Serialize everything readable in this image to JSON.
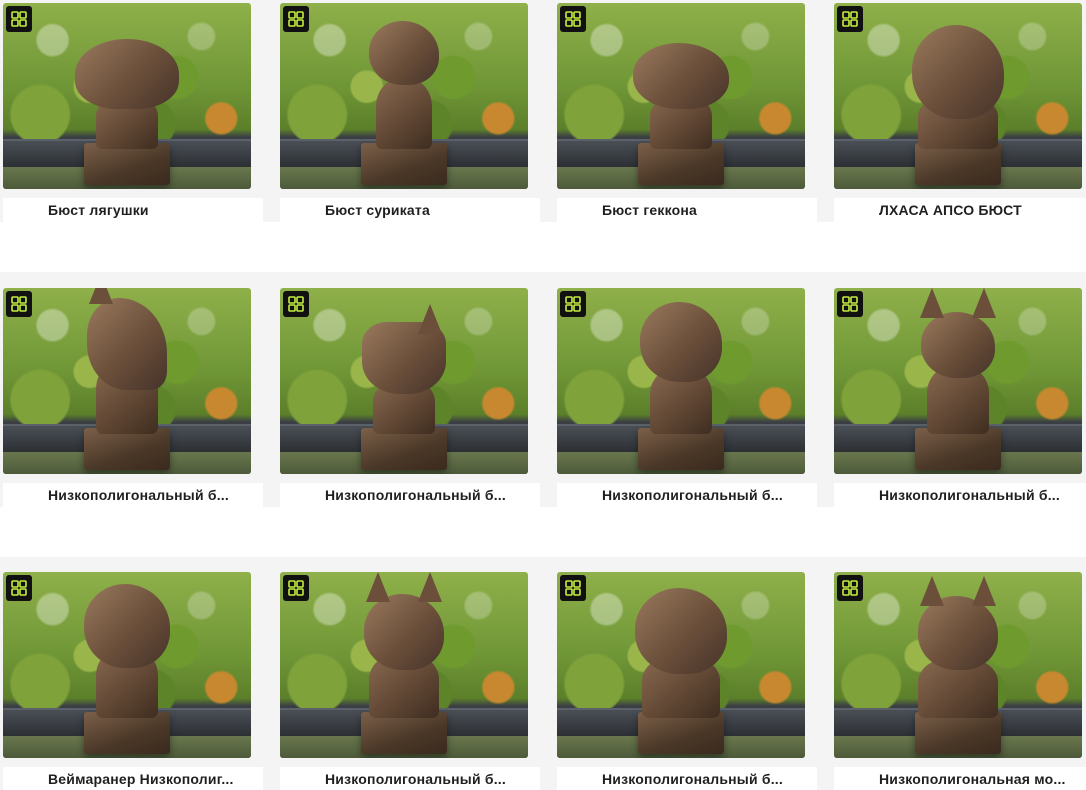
{
  "colors": {
    "page_bg": "#f4f4f4",
    "badge_bg": "#111111",
    "badge_icon": "#c6f040",
    "title_text": "#1f1f1f"
  },
  "cards": [
    {
      "title": "Бюст лягушки",
      "subject": "frog",
      "badge_icon": "cube-grid-icon"
    },
    {
      "title": "Бюст суриката",
      "subject": "meerkat",
      "badge_icon": "cube-grid-icon"
    },
    {
      "title": "Бюст геккона",
      "subject": "gecko",
      "badge_icon": "cube-grid-icon"
    },
    {
      "title": "ЛХАСА АПСО БЮСТ",
      "subject": "lhasa-apso",
      "badge_icon": "cube-grid-icon"
    },
    {
      "title": "Низкополигональный б...",
      "subject": "horse",
      "badge_icon": "cube-grid-icon"
    },
    {
      "title": "Низкополигональный б...",
      "subject": "bull",
      "badge_icon": "cube-grid-icon"
    },
    {
      "title": "Низкополигональный б...",
      "subject": "dog",
      "badge_icon": "cube-grid-icon"
    },
    {
      "title": "Низкополигональный б...",
      "subject": "dragon",
      "badge_icon": "cube-grid-icon"
    },
    {
      "title": "Веймаранер Низкополиг...",
      "subject": "weimaraner",
      "badge_icon": "cube-grid-icon"
    },
    {
      "title": "Низкополигональный б...",
      "subject": "wolf",
      "badge_icon": "cube-grid-icon"
    },
    {
      "title": "Низкополигональный б...",
      "subject": "shih-tzu",
      "badge_icon": "cube-grid-icon"
    },
    {
      "title": "Низкополигональная мо...",
      "subject": "yorkie",
      "badge_icon": "cube-grid-icon"
    }
  ]
}
